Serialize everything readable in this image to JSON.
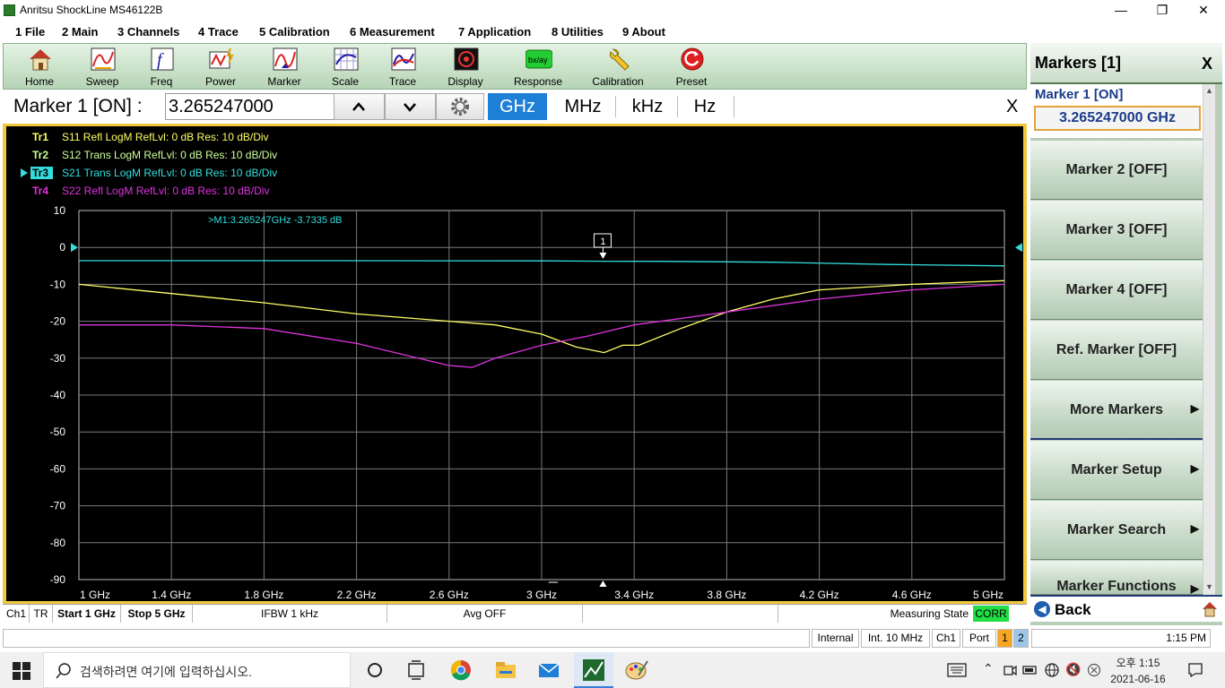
{
  "window": {
    "title": "Anritsu ShockLine MS46122B",
    "controls": [
      "—",
      "❐",
      "✕"
    ]
  },
  "menu": [
    "1 File",
    "2 Main",
    "3 Channels",
    "4 Trace",
    "5 Calibration",
    "6 Measurement",
    "7 Application",
    "8 Utilities",
    "9 About"
  ],
  "toolbar": [
    "Home",
    "Sweep",
    "Freq",
    "Power",
    "Marker",
    "Scale",
    "Trace",
    "Display",
    "Response",
    "Calibration",
    "Preset"
  ],
  "marker_bar": {
    "title": "Marker 1 [ON]  :",
    "value": "3.265247000",
    "units": [
      "GHz",
      "MHz",
      "kHz",
      "Hz"
    ],
    "selected_unit": "GHz",
    "close": "X"
  },
  "traces": [
    {
      "tag": "Tr1",
      "desc": "S11 Refl LogM RefLvl: 0  dB Res: 10  dB/Div",
      "color": "#ffff66"
    },
    {
      "tag": "Tr2",
      "desc": "S12 Trans LogM RefLvl: 0  dB Res: 10  dB/Div",
      "color": "#ccff99"
    },
    {
      "tag": "Tr3",
      "desc": "S21 Trans LogM RefLvl: 0  dB Res: 10  dB/Div",
      "color": "#33dddd"
    },
    {
      "tag": "Tr4",
      "desc": "S22 Refl LogM RefLvl: 0  dB Res: 10  dB/Div",
      "color": "#dd33dd"
    }
  ],
  "marker_readout": ">M1:3.265247GHz  -3.7335  dB",
  "marker_flag": "1",
  "chart_data": {
    "type": "line",
    "x_unit": "GHz",
    "xlim": [
      1,
      5
    ],
    "ylim": [
      -90,
      10
    ],
    "x_tick_labels": [
      "1 GHz",
      "1.4 GHz",
      "1.8 GHz",
      "2.2 GHz",
      "2.6 GHz",
      "3 GHz",
      "3.4 GHz",
      "3.8 GHz",
      "4.2 GHz",
      "4.6 GHz",
      "5 GHz"
    ],
    "y_tick_labels": [
      "10",
      "0",
      "-10",
      "-20",
      "-30",
      "-40",
      "-50",
      "-60",
      "-70",
      "-80",
      "-90"
    ],
    "grid": true,
    "series": [
      {
        "name": "S11",
        "color": "#ffff66",
        "x": [
          1.0,
          1.4,
          1.8,
          2.2,
          2.6,
          2.8,
          3.0,
          3.15,
          3.27,
          3.35,
          3.42,
          3.6,
          3.8,
          4.0,
          4.2,
          4.6,
          5.0
        ],
        "y": [
          -10,
          -12.5,
          -15,
          -18,
          -20,
          -21,
          -23.5,
          -27,
          -28.5,
          -26.5,
          -26.5,
          -22,
          -17.5,
          -14,
          -11.5,
          -10,
          -9
        ]
      },
      {
        "name": "S21",
        "color": "#33dddd",
        "x": [
          1.0,
          2.0,
          3.0,
          3.265,
          3.5,
          4.0,
          4.5,
          5.0
        ],
        "y": [
          -3.6,
          -3.6,
          -3.65,
          -3.73,
          -3.75,
          -4.0,
          -4.6,
          -5.0
        ]
      },
      {
        "name": "S22",
        "color": "#dd33dd",
        "x": [
          1.0,
          1.4,
          1.8,
          2.2,
          2.4,
          2.6,
          2.7,
          2.8,
          3.0,
          3.2,
          3.4,
          3.8,
          4.2,
          4.6,
          5.0
        ],
        "y": [
          -21,
          -21,
          -22,
          -26,
          -29,
          -32,
          -32.5,
          -30,
          -26.5,
          -24,
          -21,
          -17.5,
          -14,
          -11.5,
          -10
        ]
      }
    ],
    "marker_x": 3.265247
  },
  "status": {
    "ch": "Ch1",
    "tr": "TR",
    "start": "Start 1 GHz",
    "stop": "Stop 5 GHz",
    "ifbw": "IFBW 1 kHz",
    "avg": "Avg OFF",
    "state": "Measuring State",
    "corr": "CORR"
  },
  "bottom": {
    "internal": "Internal",
    "ref": "Int. 10 MHz",
    "ch": "Ch1",
    "port": "Port",
    "p1": "1",
    "p2": "2",
    "time": "1:15 PM"
  },
  "panel": {
    "title": "Markers [1]",
    "close": "X",
    "active_label": "Marker 1 [ON]",
    "active_value": "3.265247000 GHz",
    "buttons": [
      "Marker 2 [OFF]",
      "Marker 3 [OFF]",
      "Marker 4 [OFF]",
      "Ref. Marker [OFF]",
      "More Markers",
      "Marker Setup",
      "Marker Search",
      "Marker Functions"
    ],
    "submenu_arrow": "▶",
    "back": "Back"
  },
  "taskbar": {
    "search_placeholder": "검색하려면 여기에 입력하십시오.",
    "clock_period": "오후 1:15",
    "clock_date": "2021-06-16"
  }
}
